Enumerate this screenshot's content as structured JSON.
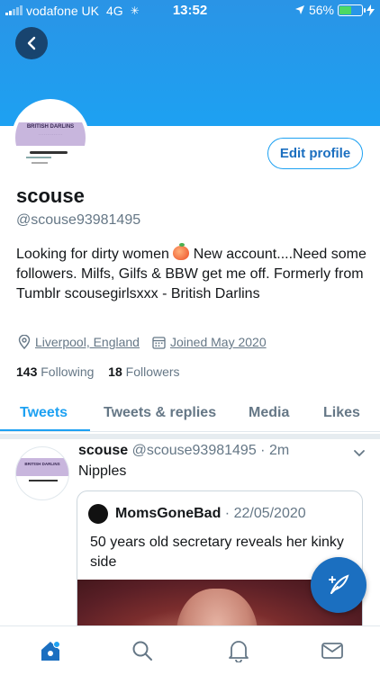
{
  "status_bar": {
    "carrier": "vodafone UK",
    "network": "4G",
    "time": "13:52",
    "battery": "56%",
    "battery_level": 0.56,
    "battery_color": "#4cd964"
  },
  "header": {
    "back_icon": "chevron-left-icon",
    "banner_color": "#1da1f2"
  },
  "profile": {
    "avatar_title": "BRITISH DARLINS",
    "edit_button": "Edit profile",
    "name": "scouse",
    "handle": "@scouse93981495",
    "bio_part1": "Looking for dirty women",
    "bio_emoji": "peach-emoji",
    "bio_part2": " New account....Need some followers. Milfs, Gilfs & BBW get me off. Formerly from Tumblr scousegirlsxxx - British Darlins",
    "location": "Liverpool, England",
    "joined": "Joined May 2020",
    "following_count": "143",
    "following_label": "Following",
    "followers_count": "18",
    "followers_label": "Followers"
  },
  "tabs": [
    {
      "label": "Tweets",
      "active": true
    },
    {
      "label": "Tweets & replies",
      "active": false
    },
    {
      "label": "Media",
      "active": false
    },
    {
      "label": "Likes",
      "active": false
    }
  ],
  "tweet": {
    "avatar_title": "BRITISH DARLINS",
    "name": "scouse",
    "handle": "@scouse93981495",
    "time": "· 2m",
    "text": "Nipples",
    "quote": {
      "name": "MomsGoneBad",
      "date": "· 22/05/2020",
      "text": "50 years old secretary reveals her kinky side"
    }
  },
  "fab": {
    "icon": "compose-tweet-icon"
  },
  "bottom_nav": [
    "home-icon",
    "search-icon",
    "notifications-icon",
    "messages-icon"
  ],
  "colors": {
    "accent": "#1da1f2",
    "accent_dark": "#1b6fc0",
    "muted": "#657786"
  }
}
